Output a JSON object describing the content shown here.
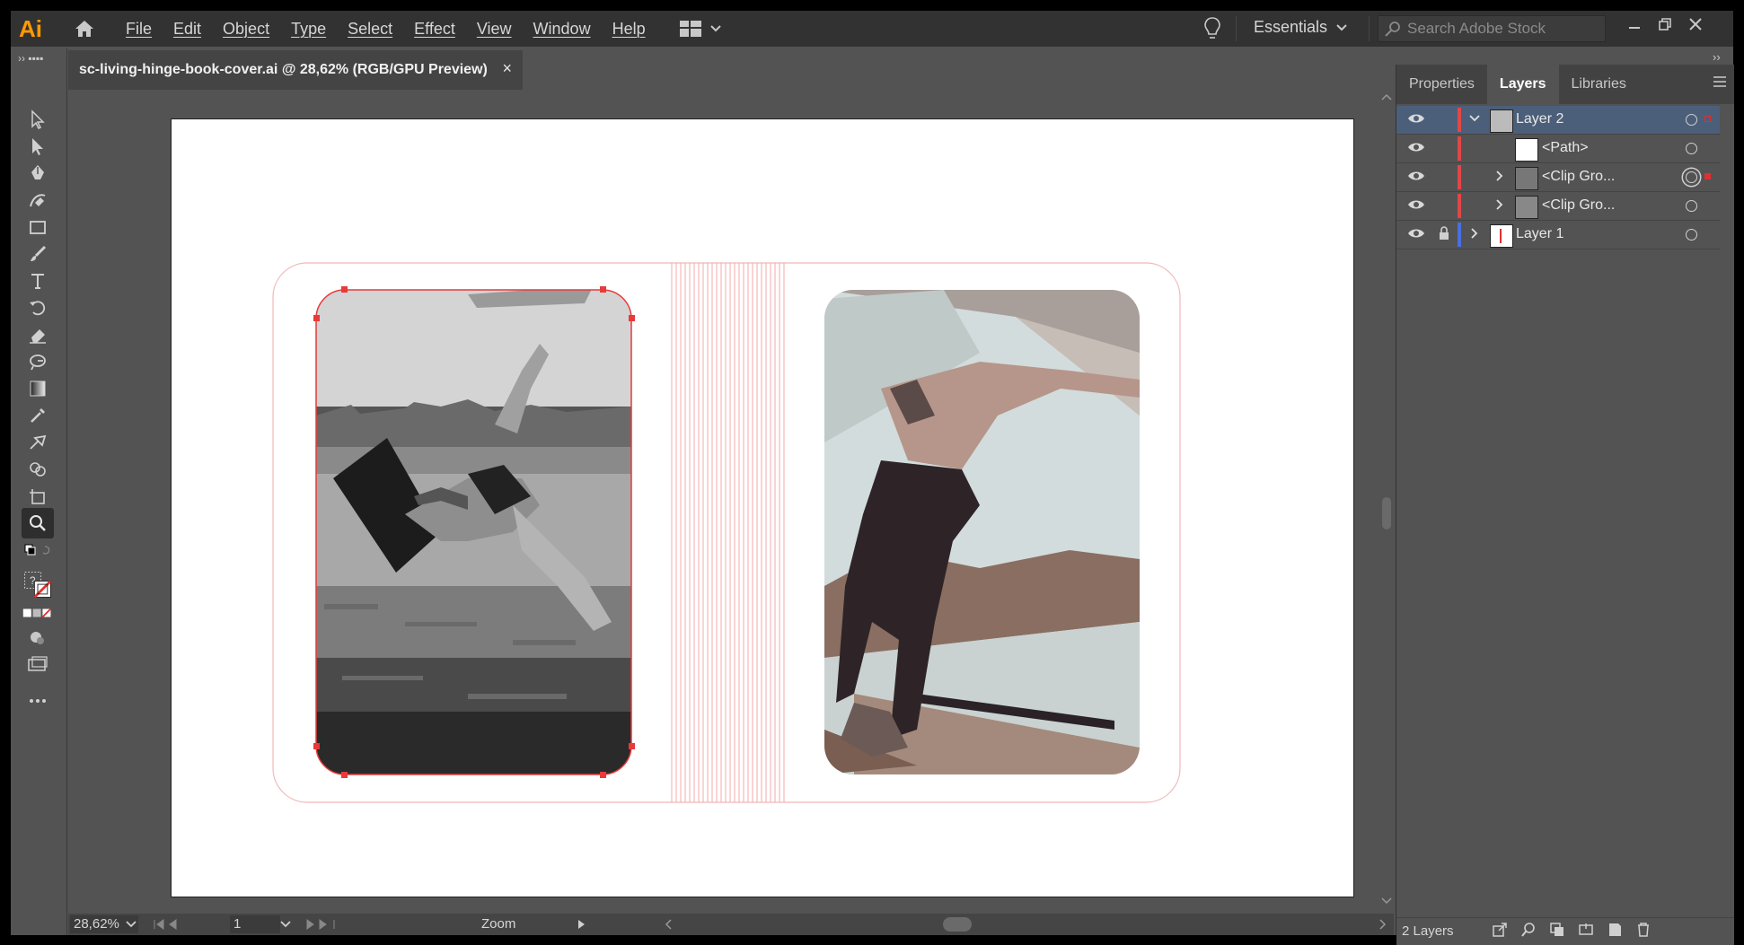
{
  "app": {
    "logo": "Ai"
  },
  "menu": [
    "File",
    "Edit",
    "Object",
    "Type",
    "Select",
    "Effect",
    "View",
    "Window",
    "Help"
  ],
  "workspace": {
    "label": "Essentials"
  },
  "search": {
    "placeholder": "Search Adobe Stock"
  },
  "document": {
    "tab_title": "sc-living-hinge-book-cover.ai @ 28,62% (RGB/GPU Preview)",
    "close": "×"
  },
  "status": {
    "zoom": "28,62%",
    "page": "1",
    "tool_label": "Zoom"
  },
  "panel": {
    "tabs": [
      "Properties",
      "Layers",
      "Libraries"
    ],
    "active_tab": "Layers",
    "layers": [
      {
        "name": "Layer 2",
        "color": "#e04848",
        "expanded": true,
        "selected": true
      },
      {
        "name": "<Path>",
        "color": "#e04848"
      },
      {
        "name": "<Clip Gro...",
        "color": "#e04848"
      },
      {
        "name": "<Clip Gro...",
        "color": "#e04848"
      },
      {
        "name": "Layer 1",
        "color": "#4a6fe0",
        "locked": true
      }
    ],
    "footer": {
      "count": "2 Layers"
    }
  },
  "colors": {
    "accent": "#ff9a00",
    "selection": "#e83a3a",
    "hinge": "#f3a0a0"
  },
  "icons": [
    "home-icon",
    "workspace-icon",
    "bulb-icon",
    "search-icon",
    "minimize-icon",
    "restore-icon",
    "close-icon",
    "eye-icon",
    "lock-icon",
    "chevron-icon",
    "target-icon",
    "trash-icon"
  ]
}
